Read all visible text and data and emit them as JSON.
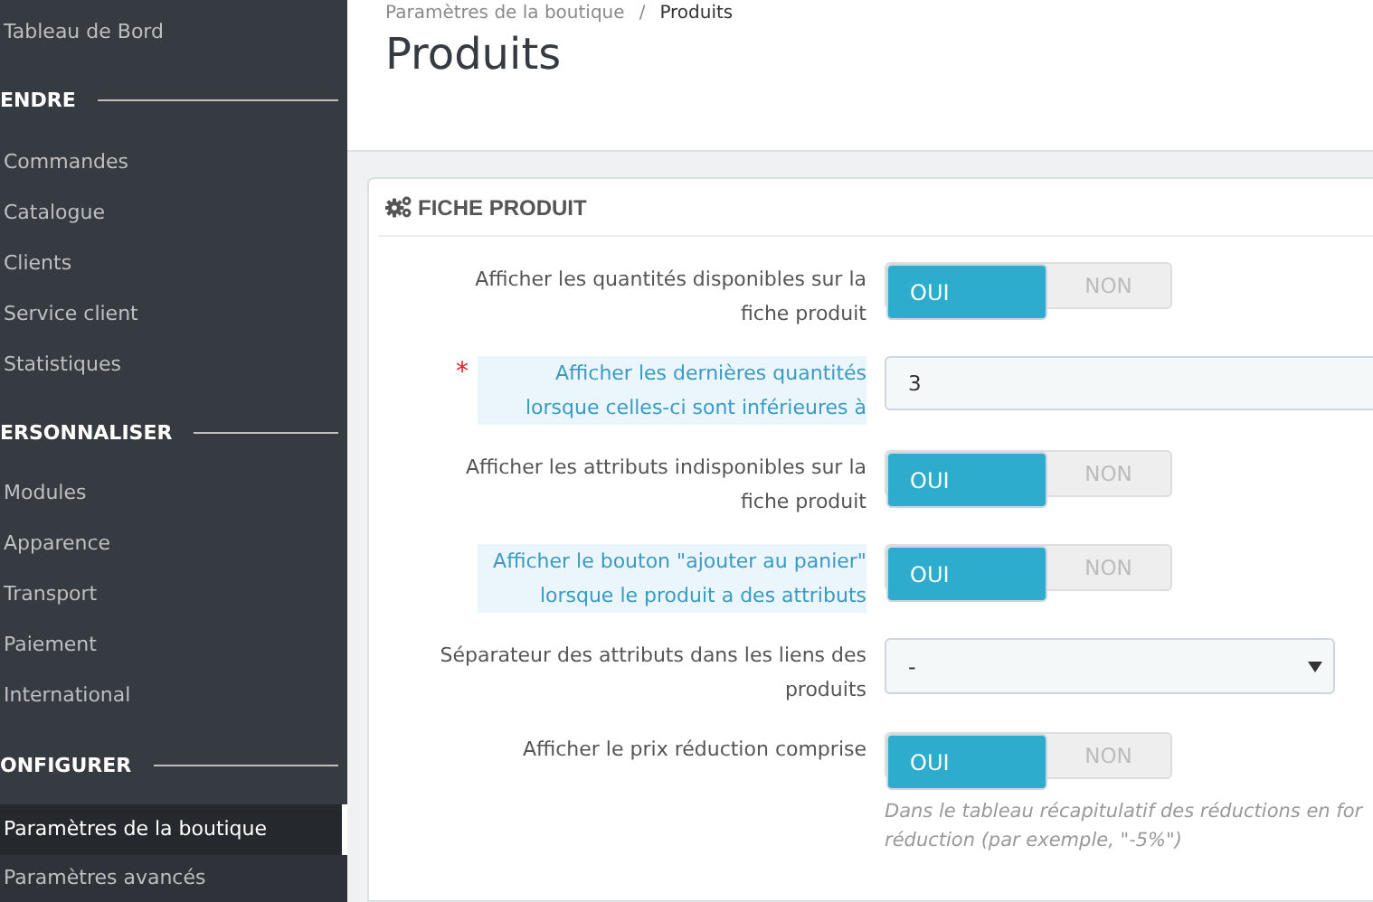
{
  "sidebar": {
    "items": [
      {
        "kind": "link",
        "label": "Tableau de Bord",
        "selected": false
      },
      {
        "kind": "section",
        "label": "ENDRE"
      },
      {
        "kind": "link",
        "label": "Commandes",
        "selected": false
      },
      {
        "kind": "link",
        "label": "Catalogue",
        "selected": false
      },
      {
        "kind": "link",
        "label": "Clients",
        "selected": false
      },
      {
        "kind": "link",
        "label": "Service client",
        "selected": false
      },
      {
        "kind": "link",
        "label": "Statistiques",
        "selected": false
      },
      {
        "kind": "section",
        "label": "ERSONNALISER"
      },
      {
        "kind": "link",
        "label": "Modules",
        "selected": false
      },
      {
        "kind": "link",
        "label": "Apparence",
        "selected": false
      },
      {
        "kind": "link",
        "label": "Transport",
        "selected": false
      },
      {
        "kind": "link",
        "label": "Paiement",
        "selected": false
      },
      {
        "kind": "link",
        "label": "International",
        "selected": false
      },
      {
        "kind": "section",
        "label": "ONFIGURER"
      },
      {
        "kind": "link",
        "label": "Paramètres de la boutique",
        "selected": true
      },
      {
        "kind": "sublink",
        "label": "Paramètres avancés",
        "selected": false
      }
    ]
  },
  "breadcrumb": [
    "Paramètres de la boutique",
    "/",
    "Produits"
  ],
  "page_title": "Produits",
  "panel": {
    "title": "FICHE PRODUIT",
    "rows": [
      {
        "kind": "toggle",
        "label": "Afficher les quantités disponibles sur la fiche produit",
        "hint": false,
        "options": [
          {
            "label": "OUI",
            "selected": true
          },
          {
            "label": "NON",
            "selected": false
          }
        ]
      },
      {
        "kind": "text",
        "label": "Afficher les dernières quantités lorsque celles-ci sont inférieures à",
        "hint": true,
        "required_mark": "*",
        "value": "3"
      },
      {
        "kind": "toggle",
        "label": "Afficher les attributs indisponibles sur la fiche produit",
        "hint": false,
        "options": [
          {
            "label": "OUI",
            "selected": true
          },
          {
            "label": "NON",
            "selected": false
          }
        ]
      },
      {
        "kind": "toggle",
        "label": "Afficher le bouton \"ajouter au panier\" lorsque le produit a des attributs",
        "hint": true,
        "options": [
          {
            "label": "OUI",
            "selected": true
          },
          {
            "label": "NON",
            "selected": false
          }
        ]
      },
      {
        "kind": "select",
        "label": "Séparateur des attributs dans les liens des produits",
        "hint": false,
        "value": "-"
      },
      {
        "kind": "toggle",
        "label": "Afficher le prix réduction comprise",
        "hint": false,
        "options": [
          {
            "label": "OUI",
            "selected": true
          },
          {
            "label": "NON",
            "selected": false
          }
        ],
        "help": [
          "Dans le tableau récapitulatif des réductions en for",
          "réduction (par exemple, \"-5%\")"
        ]
      }
    ]
  }
}
